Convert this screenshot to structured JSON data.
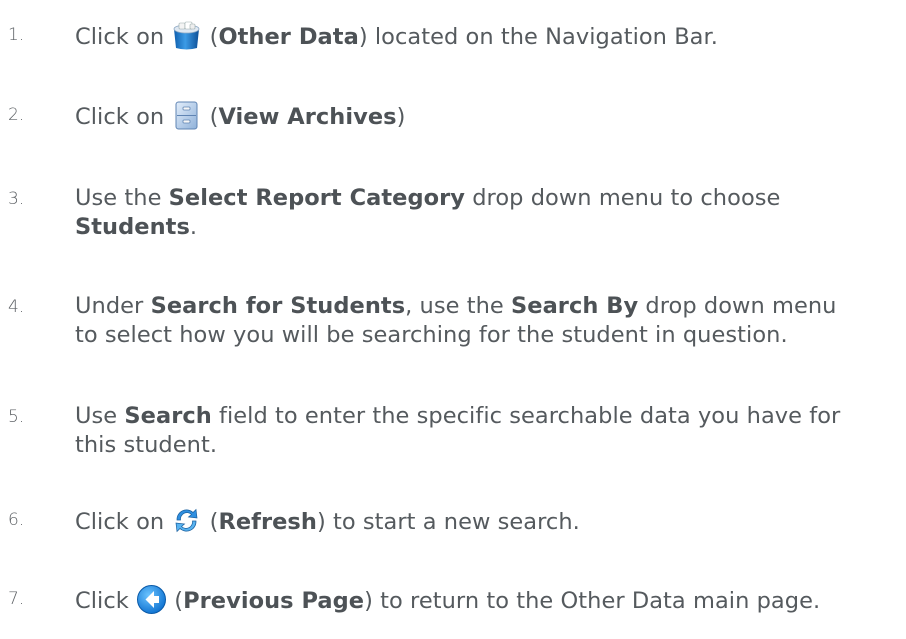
{
  "steps": [
    {
      "num": "1.",
      "before": "Click on ",
      "icon": "other-data-icon",
      "bold": "Other Data",
      "after": ") located on the Navigation Bar."
    },
    {
      "num": "2.",
      "before": "Click on ",
      "icon": "view-archives-icon",
      "bold": "View Archives",
      "after": ")"
    },
    {
      "num": "3.",
      "pre": "Use the ",
      "bold1": "Select Report Category",
      "mid": " drop down menu to choose",
      "bold2": "Students",
      "post": "."
    },
    {
      "num": "4.",
      "pre": "Under ",
      "bold1": "Search for Students",
      "mid": ", use the ",
      "bold2": "Search By",
      "post": " drop down menu",
      "line2": "to select how you will be searching for the student in question."
    },
    {
      "num": "5.",
      "pre": "Use ",
      "bold1": "Search",
      "post": " field to enter the specific searchable data you have for",
      "line2": "this student."
    },
    {
      "num": "6.",
      "before": "Click on ",
      "icon": "refresh-icon",
      "bold": "Refresh",
      "after": ") to start a new search."
    },
    {
      "num": "7.",
      "before": "Click ",
      "icon": "previous-page-icon",
      "bold": "Previous Page",
      "after": ") to return to the Other Data main page."
    }
  ]
}
